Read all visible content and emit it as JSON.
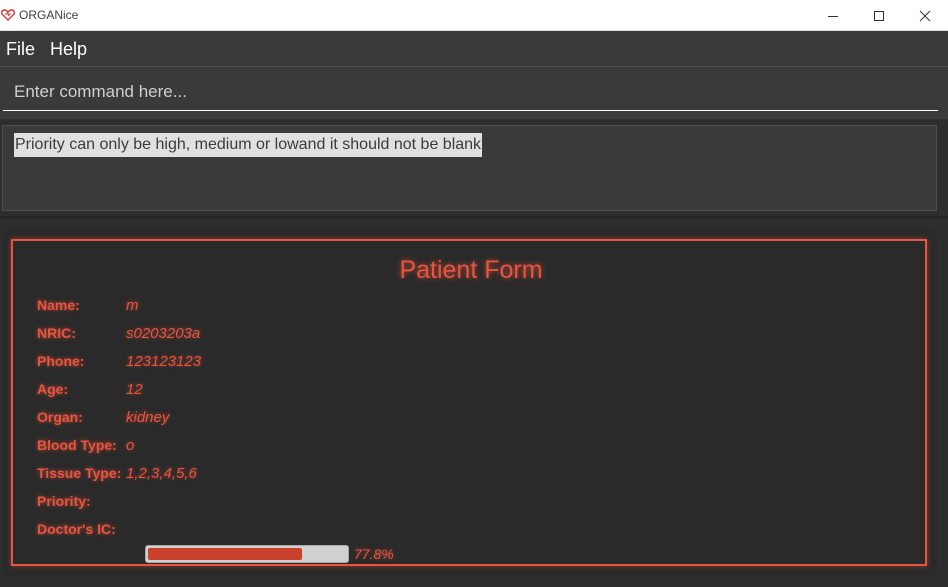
{
  "window": {
    "title": "ORGANice",
    "controls": {
      "minimize": "minimize-icon",
      "maximize": "maximize-icon",
      "close": "close-icon"
    }
  },
  "menu": {
    "file": "File",
    "help": "Help"
  },
  "command": {
    "placeholder": "Enter command here...",
    "value": ""
  },
  "result": {
    "message": "Priority can only be high, medium or lowand it should not be blank"
  },
  "form": {
    "title": "Patient Form",
    "fields": [
      {
        "label": "Name:",
        "value": "m"
      },
      {
        "label": "NRIC:",
        "value": "s0203203a"
      },
      {
        "label": "Phone:",
        "value": "123123123"
      },
      {
        "label": "Age:",
        "value": "12"
      },
      {
        "label": "Organ:",
        "value": "kidney"
      },
      {
        "label": "Blood Type:",
        "value": "o"
      },
      {
        "label": "Tissue Type:",
        "value": "1,2,3,4,5,6"
      },
      {
        "label": "Priority:",
        "value": ""
      },
      {
        "label": "Doctor's IC:",
        "value": ""
      }
    ],
    "progress": {
      "percent": 77.8,
      "label": "77.8%"
    }
  },
  "colors": {
    "accent": "#e8543e",
    "progress_fill": "#c9402c",
    "background": "#2e2e2e"
  }
}
